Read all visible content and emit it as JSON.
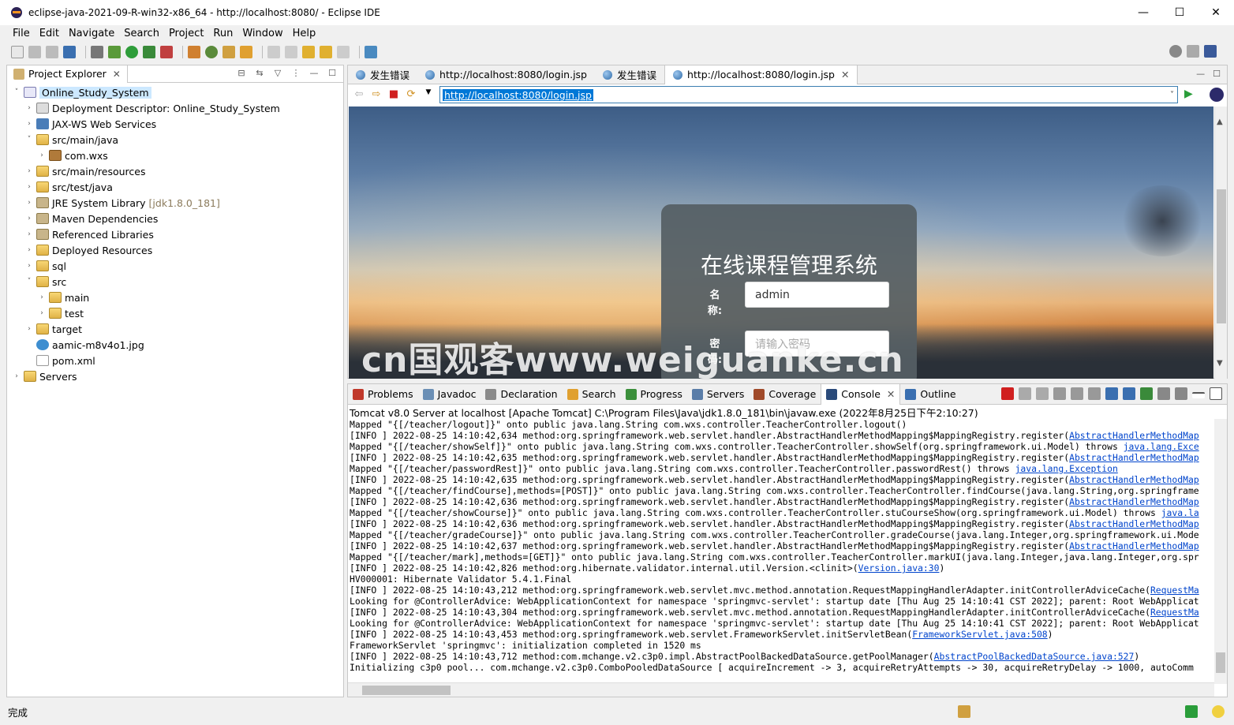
{
  "window": {
    "title": "eclipse-java-2021-09-R-win32-x86_64 - http://localhost:8080/ - Eclipse IDE",
    "minimize": "—",
    "maximize": "☐",
    "close": "✕"
  },
  "menu": [
    "File",
    "Edit",
    "Navigate",
    "Search",
    "Project",
    "Run",
    "Window",
    "Help"
  ],
  "explorer": {
    "tab_label": "Project Explorer",
    "items": [
      {
        "label": "Online_Study_System",
        "arrow": "˅",
        "indent": 0,
        "icon": "project-icon",
        "selected": true
      },
      {
        "label": "Deployment Descriptor: Online_Study_System",
        "arrow": "›",
        "indent": 1,
        "icon": "descriptor-icon"
      },
      {
        "label": "JAX-WS Web Services",
        "arrow": "›",
        "indent": 1,
        "icon": "webservice-icon"
      },
      {
        "label": "src/main/java",
        "arrow": "˅",
        "indent": 1,
        "icon": "source-folder-icon"
      },
      {
        "label": "com.wxs",
        "arrow": "›",
        "indent": 2,
        "icon": "package-icon"
      },
      {
        "label": "src/main/resources",
        "arrow": "›",
        "indent": 1,
        "icon": "source-folder-icon"
      },
      {
        "label": "src/test/java",
        "arrow": "›",
        "indent": 1,
        "icon": "source-folder-icon"
      },
      {
        "label": "JRE System Library",
        "decoration": "[jdk1.8.0_181]",
        "arrow": "›",
        "indent": 1,
        "icon": "library-icon"
      },
      {
        "label": "Maven Dependencies",
        "arrow": "›",
        "indent": 1,
        "icon": "library-icon"
      },
      {
        "label": "Referenced Libraries",
        "arrow": "›",
        "indent": 1,
        "icon": "library-icon"
      },
      {
        "label": "Deployed Resources",
        "arrow": "›",
        "indent": 1,
        "icon": "folder-icon"
      },
      {
        "label": "sql",
        "arrow": "›",
        "indent": 1,
        "icon": "folder-icon"
      },
      {
        "label": "src",
        "arrow": "˅",
        "indent": 1,
        "icon": "folder-icon"
      },
      {
        "label": "main",
        "arrow": "›",
        "indent": 2,
        "icon": "folder-icon"
      },
      {
        "label": "test",
        "arrow": "›",
        "indent": 2,
        "icon": "folder-icon"
      },
      {
        "label": "target",
        "arrow": "›",
        "indent": 1,
        "icon": "folder-icon"
      },
      {
        "label": "aamic-m8v4o1.jpg",
        "arrow": "",
        "indent": 1,
        "icon": "image-file-icon"
      },
      {
        "label": "pom.xml",
        "arrow": "",
        "indent": 1,
        "icon": "xml-file-icon"
      },
      {
        "label": "Servers",
        "arrow": "›",
        "indent": 0,
        "icon": "folder-icon"
      }
    ]
  },
  "browser": {
    "tabs": [
      {
        "label": "发生错误",
        "active": false
      },
      {
        "label": "http://localhost:8080/login.jsp",
        "active": false
      },
      {
        "label": "发生错误",
        "active": false
      },
      {
        "label": "http://localhost:8080/login.jsp",
        "active": true
      }
    ],
    "url": "http://localhost:8080/login.jsp",
    "login": {
      "title": "在线课程管理系统",
      "name_label": "名\n称:",
      "name_value": "admin",
      "password_label": "密\n码:",
      "password_placeholder": "请输入密码"
    }
  },
  "watermark": "cn国观客www.weiguanke.cn",
  "bottom": {
    "tabs": [
      {
        "label": "Problems",
        "color": "#c0392b",
        "active": false
      },
      {
        "label": "Javadoc",
        "color": "#6b8fb5",
        "active": false
      },
      {
        "label": "Declaration",
        "color": "#8a8a8a",
        "active": false
      },
      {
        "label": "Search",
        "color": "#e0a030",
        "active": false
      },
      {
        "label": "Progress",
        "color": "#3b8f3b",
        "active": false
      },
      {
        "label": "Servers",
        "color": "#5a7da8",
        "active": false
      },
      {
        "label": "Coverage",
        "color": "#a04a2a",
        "active": false
      },
      {
        "label": "Console",
        "color": "#2a4a7a",
        "active": true
      },
      {
        "label": "Outline",
        "color": "#3a6fb0",
        "active": false
      }
    ],
    "process": "Tomcat v8.0 Server at localhost [Apache Tomcat] C:\\Program Files\\Java\\jdk1.8.0_181\\bin\\javaw.exe  (2022年8月25日下午2:10:27)",
    "console_lines": [
      {
        "text": "Mapped \"{[/teacher/logout]}\" onto public java.lang.String com.wxs.controller.TeacherController.logout()",
        "link": ""
      },
      {
        "text": "[INFO ] 2022-08-25 14:10:42,634 method:org.springframework.web.servlet.handler.AbstractHandlerMethodMapping$MappingRegistry.register(",
        "link": "AbstractHandlerMethodMap"
      },
      {
        "text": "Mapped \"{[/teacher/showSelf]}\" onto public java.lang.String com.wxs.controller.TeacherController.showSelf(org.springframework.ui.Model) throws ",
        "link": "java.lang.Exce"
      },
      {
        "text": "[INFO ] 2022-08-25 14:10:42,635 method:org.springframework.web.servlet.handler.AbstractHandlerMethodMapping$MappingRegistry.register(",
        "link": "AbstractHandlerMethodMap"
      },
      {
        "text": "Mapped \"{[/teacher/passwordRest]}\" onto public java.lang.String com.wxs.controller.TeacherController.passwordRest() throws ",
        "link": "java.lang.Exception"
      },
      {
        "text": "[INFO ] 2022-08-25 14:10:42,635 method:org.springframework.web.servlet.handler.AbstractHandlerMethodMapping$MappingRegistry.register(",
        "link": "AbstractHandlerMethodMap"
      },
      {
        "text": "Mapped \"{[/teacher/findCourse],methods=[POST]}\" onto public java.lang.String com.wxs.controller.TeacherController.findCourse(java.lang.String,org.springframe",
        "link": ""
      },
      {
        "text": "[INFO ] 2022-08-25 14:10:42,636 method:org.springframework.web.servlet.handler.AbstractHandlerMethodMapping$MappingRegistry.register(",
        "link": "AbstractHandlerMethodMap"
      },
      {
        "text": "Mapped \"{[/teacher/showCourse]}\" onto public java.lang.String com.wxs.controller.TeacherController.stuCourseShow(org.springframework.ui.Model) throws ",
        "link": "java.la"
      },
      {
        "text": "[INFO ] 2022-08-25 14:10:42,636 method:org.springframework.web.servlet.handler.AbstractHandlerMethodMapping$MappingRegistry.register(",
        "link": "AbstractHandlerMethodMap"
      },
      {
        "text": "Mapped \"{[/teacher/gradeCourse]}\" onto public java.lang.String com.wxs.controller.TeacherController.gradeCourse(java.lang.Integer,org.springframework.ui.Mode",
        "link": ""
      },
      {
        "text": "[INFO ] 2022-08-25 14:10:42,637 method:org.springframework.web.servlet.handler.AbstractHandlerMethodMapping$MappingRegistry.register(",
        "link": "AbstractHandlerMethodMap"
      },
      {
        "text": "Mapped \"{[/teacher/mark],methods=[GET]}\" onto public java.lang.String com.wxs.controller.TeacherController.markUI(java.lang.Integer,java.lang.Integer,org.spr",
        "link": ""
      },
      {
        "text": "[INFO ] 2022-08-25 14:10:42,826 method:org.hibernate.validator.internal.util.Version.<clinit>(",
        "link": "Version.java:30",
        "tail": ")"
      },
      {
        "text": "HV000001: Hibernate Validator 5.4.1.Final",
        "link": ""
      },
      {
        "text": "[INFO ] 2022-08-25 14:10:43,212 method:org.springframework.web.servlet.mvc.method.annotation.RequestMappingHandlerAdapter.initControllerAdviceCache(",
        "link": "RequestMa"
      },
      {
        "text": "Looking for @ControllerAdvice: WebApplicationContext for namespace 'springmvc-servlet': startup date [Thu Aug 25 14:10:41 CST 2022]; parent: Root WebApplicat",
        "link": ""
      },
      {
        "text": "[INFO ] 2022-08-25 14:10:43,304 method:org.springframework.web.servlet.mvc.method.annotation.RequestMappingHandlerAdapter.initControllerAdviceCache(",
        "link": "RequestMa"
      },
      {
        "text": "Looking for @ControllerAdvice: WebApplicationContext for namespace 'springmvc-servlet': startup date [Thu Aug 25 14:10:41 CST 2022]; parent: Root WebApplicat",
        "link": ""
      },
      {
        "text": "[INFO ] 2022-08-25 14:10:43,453 method:org.springframework.web.servlet.FrameworkServlet.initServletBean(",
        "link": "FrameworkServlet.java:508",
        "tail": ")"
      },
      {
        "text": "FrameworkServlet 'springmvc': initialization completed in 1520 ms",
        "link": ""
      },
      {
        "text": "[INFO ] 2022-08-25 14:10:43,712 method:com.mchange.v2.c3p0.impl.AbstractPoolBackedDataSource.getPoolManager(",
        "link": "AbstractPoolBackedDataSource.java:527",
        "tail": ")"
      },
      {
        "text": "Initializing c3p0 pool... com.mchange.v2.c3p0.ComboPooledDataSource [ acquireIncrement -> 3, acquireRetryAttempts -> 30, acquireRetryDelay -> 1000, autoComm",
        "link": ""
      }
    ]
  },
  "status": {
    "text": "完成"
  }
}
